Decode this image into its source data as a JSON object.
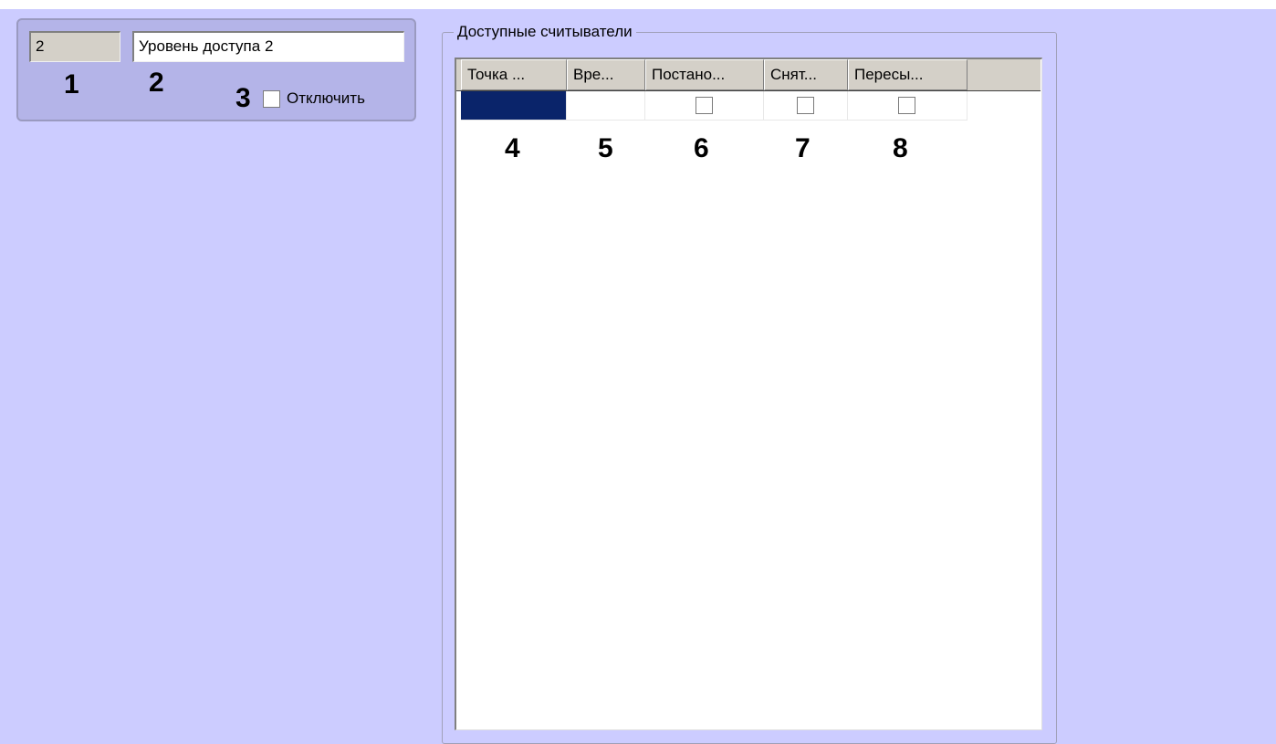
{
  "level": {
    "id_value": "2",
    "name_value": "Уровень доступа 2",
    "disable_label": "Отключить",
    "disable_checked": false
  },
  "callouts": [
    "1",
    "2",
    "3",
    "4",
    "5",
    "6",
    "7",
    "8"
  ],
  "readers": {
    "group_title": "Доступные считыватели",
    "columns": [
      "Точка ...",
      "Вре...",
      "Постано...",
      "Снят...",
      "Пересы..."
    ],
    "rows": [
      {
        "point": "",
        "time": "",
        "arm": false,
        "disarm": false,
        "forward": false,
        "selected": true
      }
    ]
  },
  "colors": {
    "background": "#ccccff",
    "panel": "#b4b4e8",
    "selection": "#0a246a"
  },
  "icons": [
    "checkbox-icon"
  ]
}
